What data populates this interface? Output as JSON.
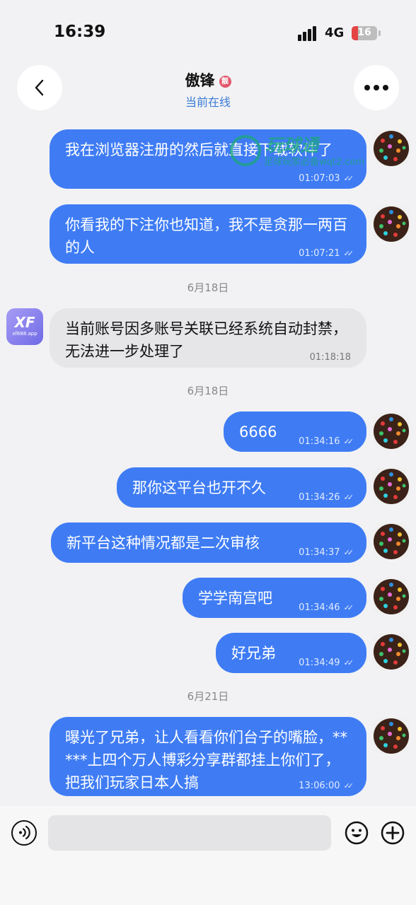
{
  "status_bar": {
    "time": "16:39",
    "network": "4G",
    "battery": "16"
  },
  "header": {
    "name": "傲锋",
    "badge": "靓",
    "status": "当前在线"
  },
  "watermark": {
    "title": "玩球通",
    "subtitle": "足球玩家必备wqt2.com"
  },
  "avatar_xf": {
    "logo": "XF",
    "site": "xf688.app"
  },
  "messages": [
    {
      "text": "我在浏览器注册的然后就直接下载软件了",
      "time": "01:07:03"
    },
    {
      "text": "你看我的下注你也知道，我不是贪那一两百的人",
      "time": "01:07:21"
    },
    {
      "date": "6月18日"
    },
    {
      "text": "当前账号因多账号关联已经系统自动封禁，无法进一步处理了",
      "time": "01:18:18"
    },
    {
      "date": "6月18日"
    },
    {
      "text": "6666",
      "time": "01:34:16"
    },
    {
      "text": "那你这平台也开不久",
      "time": "01:34:26"
    },
    {
      "text": "新平台这种情况都是二次审核",
      "time": "01:34:37"
    },
    {
      "text": "学学南宫吧",
      "time": "01:34:46"
    },
    {
      "text": "好兄弟",
      "time": "01:34:49"
    },
    {
      "date": "6月21日"
    },
    {
      "text": "曝光了兄弟，让人看看你们台子的嘴脸，*****上四个万人博彩分享群都挂上你们了，把我们玩家日本人搞",
      "time": "13:06:00"
    }
  ]
}
